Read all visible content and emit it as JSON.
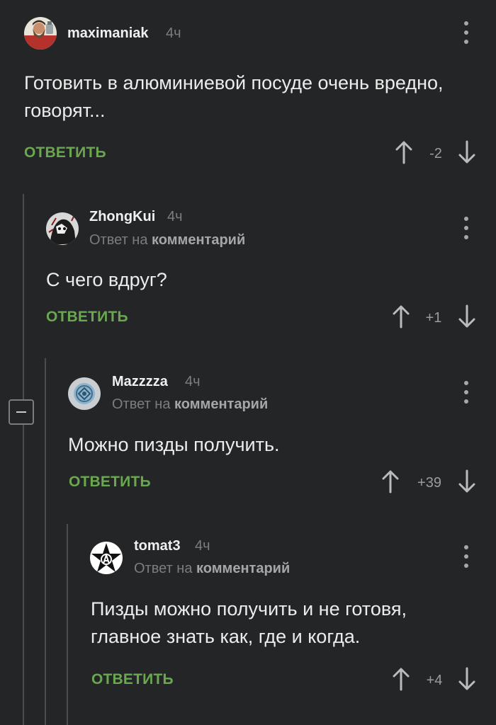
{
  "comments": [
    {
      "username": "maximaniak",
      "time": "4ч",
      "reply_prefix": "",
      "reply_target": "",
      "text": "Готовить в алюминиевой посуде очень вредно, говорят...",
      "reply_label": "ОТВЕТИТЬ",
      "score": "-2",
      "avatar_icon": "bearded-man-avatar"
    },
    {
      "username": "ZhongKui",
      "time": "4ч",
      "reply_prefix": "Ответ на",
      "reply_target": "комментарий",
      "text": "С чего вдруг?",
      "reply_label": "ОТВЕТИТЬ",
      "score": "+1",
      "avatar_icon": "ink-drawing-avatar"
    },
    {
      "username": "Mazzzza",
      "time": "4ч",
      "reply_prefix": "Ответ на",
      "reply_target": "комментарий",
      "text": "Можно пизды получить.",
      "reply_label": "ОТВЕТИТЬ",
      "score": "+39",
      "avatar_icon": "blue-emblem-avatar"
    },
    {
      "username": "tomat3",
      "time": "4ч",
      "reply_prefix": "Ответ на",
      "reply_target": "комментарий",
      "text": "Пизды можно получить и не готовя, главное знать как, где и когда.",
      "reply_label": "ОТВЕТИТЬ",
      "score": "+4",
      "avatar_icon": "anarchy-star-avatar"
    }
  ],
  "colors": {
    "background": "#232527",
    "reply_green": "#6aa84f",
    "muted_text": "#7b7e81",
    "thread_line": "#4a4d50"
  }
}
